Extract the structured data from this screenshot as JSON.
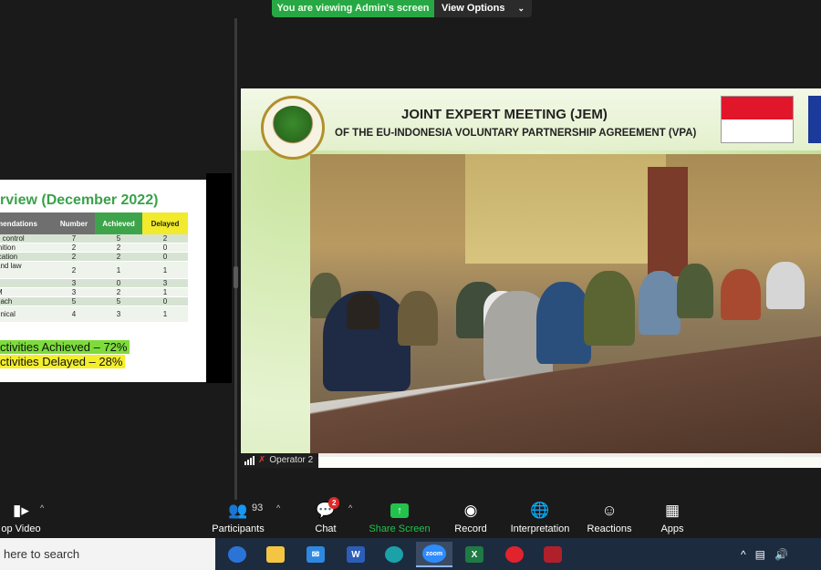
{
  "banner": {
    "text": "You are viewing Admin's screen",
    "view_options": "View Options"
  },
  "slide": {
    "title": "rview (December 2022)",
    "headers": [
      "mendations",
      "Number",
      "Achieved",
      "Delayed"
    ],
    "rows": [
      [
        "n control",
        "7",
        "5",
        "2"
      ],
      [
        "inition",
        "2",
        "2",
        "0"
      ],
      [
        "ication",
        "2",
        "2",
        "0"
      ],
      [
        "and law\nt",
        "2",
        "1",
        "1"
      ],
      [
        "",
        "3",
        "0",
        "3"
      ],
      [
        "M",
        "3",
        "2",
        "1"
      ],
      [
        "each",
        "5",
        "5",
        "0"
      ],
      [
        "hnical",
        "4",
        "3",
        "1"
      ]
    ],
    "summary_achieved": "ctivities Achieved – 72%",
    "summary_delayed": "ctivities Delayed – 28%"
  },
  "video": {
    "title_line1": "JOINT EXPERT MEETING (JEM)",
    "title_line2": "OF THE EU-INDONESIA VOLUNTARY PARTNERSHIP AGREEMENT (VPA)",
    "participant_name": "Operator 2"
  },
  "toolbar": {
    "video_label": "op Video",
    "participants_label": "Participants",
    "participants_count": "93",
    "chat_label": "Chat",
    "chat_badge": "2",
    "share_label": "Share Screen",
    "record_label": "Record",
    "interpretation_label": "Interpretation",
    "reactions_label": "Reactions",
    "apps_label": "Apps"
  },
  "taskbar": {
    "search_text": "here to search",
    "apps": [
      "edge-like",
      "file-explorer",
      "mail",
      "word",
      "edge",
      "zoom",
      "excel",
      "opera",
      "app"
    ],
    "zoom_label": "zoom",
    "word_label": "W",
    "excel_label": "X"
  },
  "colors": {
    "share_green": "#23c24d",
    "banner_green": "#27a844",
    "slide_green": "#3aa14a",
    "badge_red": "#e02828"
  }
}
